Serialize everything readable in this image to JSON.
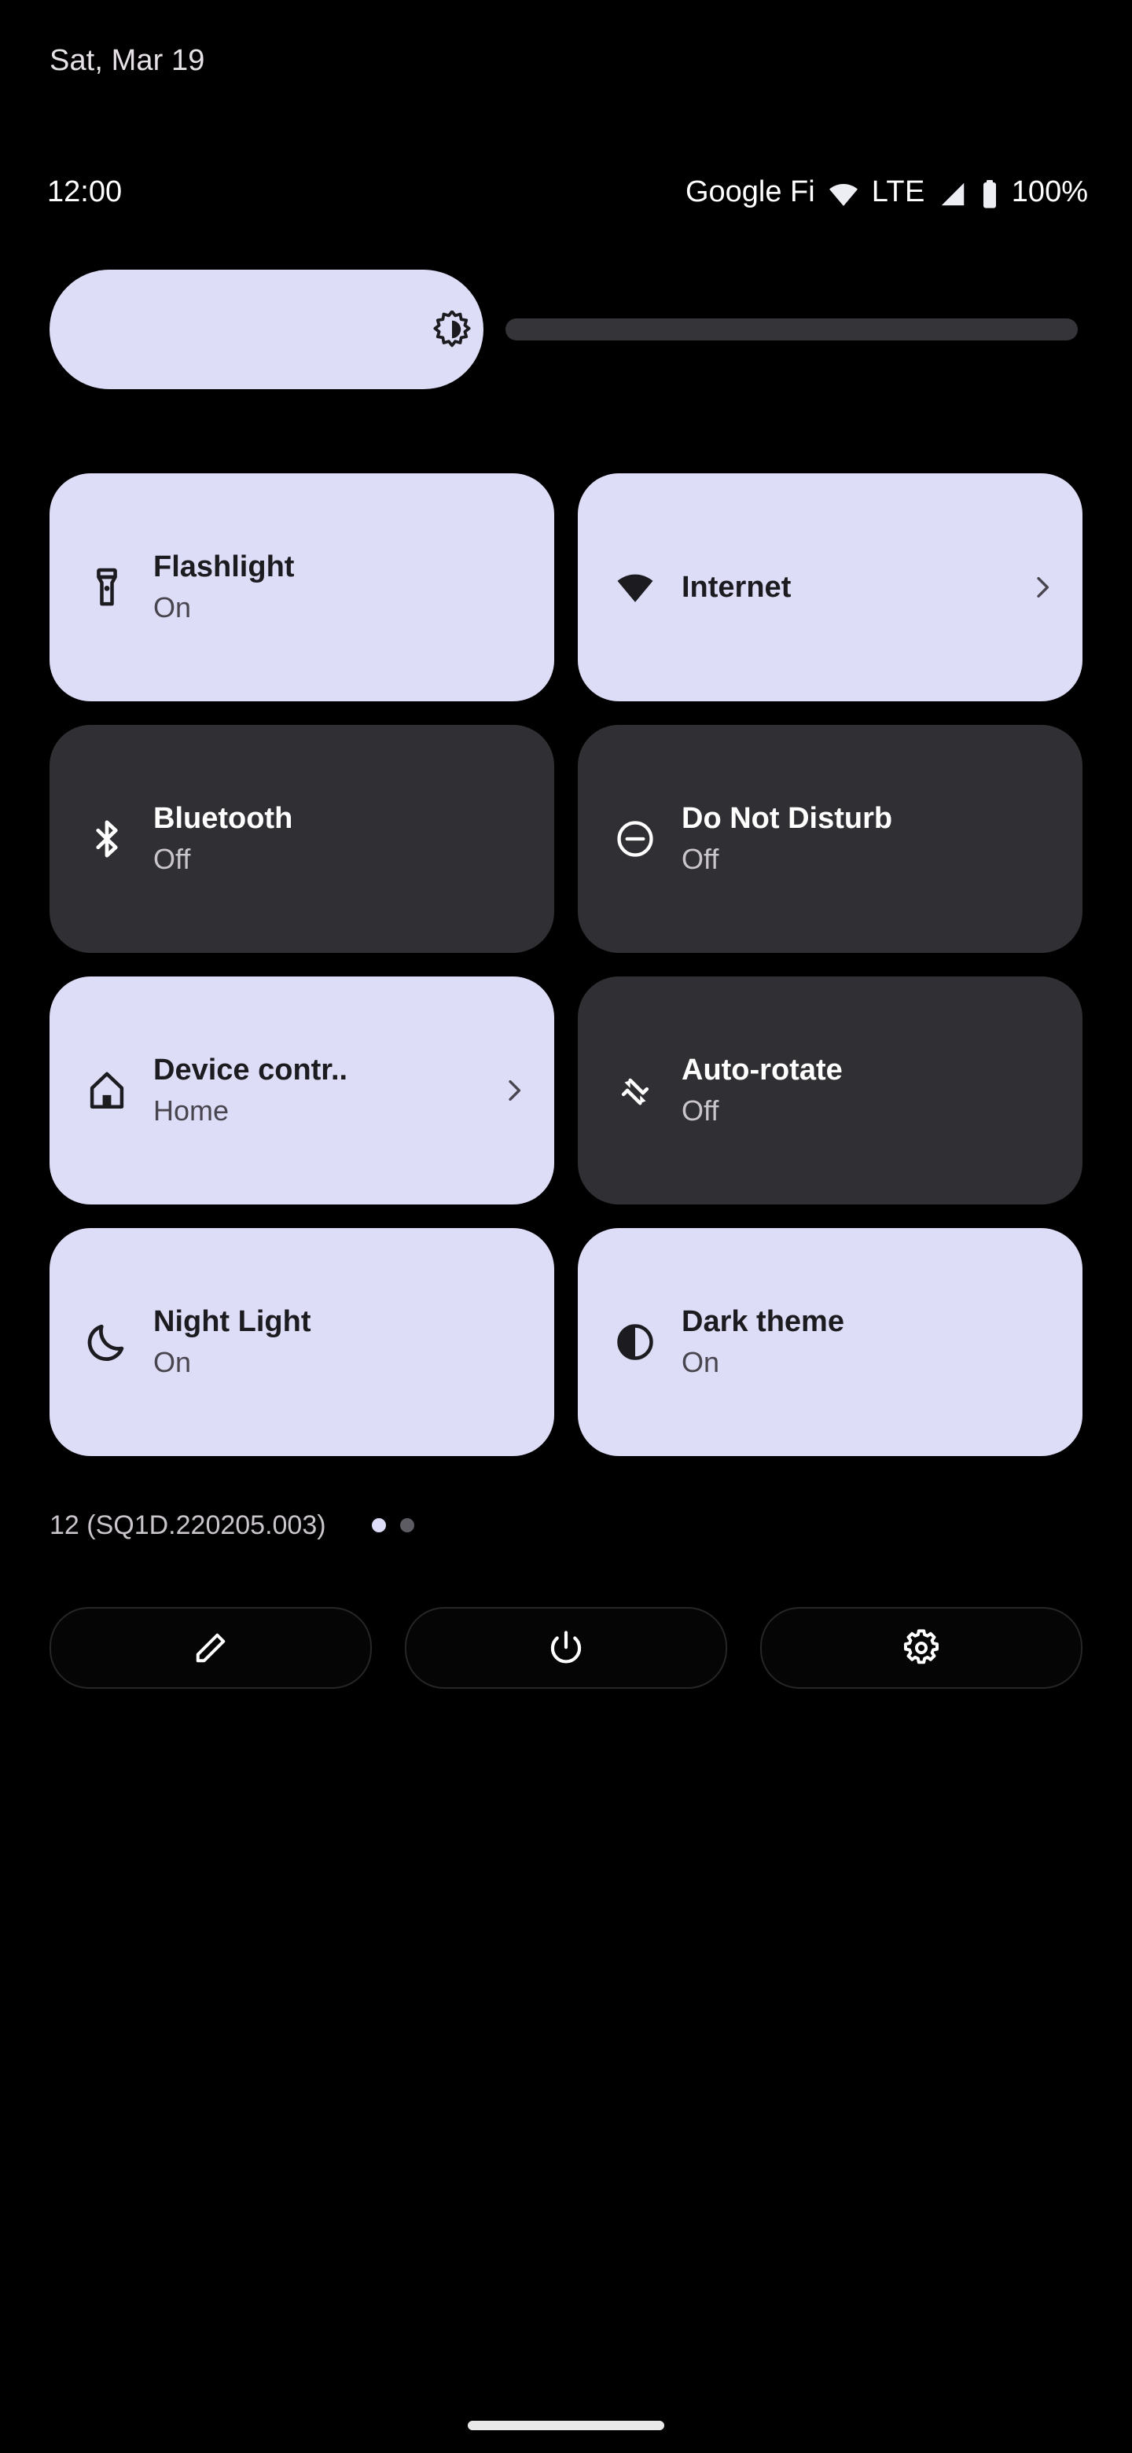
{
  "statusbar": {
    "date": "Sat, Mar 19",
    "clock": "12:00",
    "carrier": "Google Fi",
    "network_type": "LTE",
    "battery_percent": "100%",
    "wifi_icon": "wifi-icon",
    "signal_icon": "cell-signal-icon",
    "battery_icon": "battery-full-icon"
  },
  "brightness": {
    "name": "brightness-slider",
    "icon": "brightness-icon",
    "value_percent": 42,
    "fill_color": "#DEDDF8",
    "track_color": "#353438"
  },
  "colors": {
    "background": "#000000",
    "tile_active_bg": "#DEDDF8",
    "tile_inactive_bg": "#303034",
    "tile_active_text": "#1C1B1F",
    "tile_active_subtext": "#49454E",
    "tile_inactive_text": "#FFFFFF",
    "tile_inactive_subtext": "#C9C5CA",
    "dot_active": "#DEDDF8",
    "dot_inactive": "#5C5C62"
  },
  "tiles": [
    {
      "id": "flashlight",
      "label": "Flashlight",
      "sub": "On",
      "state": "active",
      "icon": "flashlight-icon",
      "chevron": false
    },
    {
      "id": "internet",
      "label": "Internet",
      "sub": "",
      "state": "active",
      "icon": "wifi-icon",
      "chevron": true
    },
    {
      "id": "bluetooth",
      "label": "Bluetooth",
      "sub": "Off",
      "state": "inactive",
      "icon": "bluetooth-icon",
      "chevron": false
    },
    {
      "id": "do-not-disturb",
      "label": "Do Not Disturb",
      "sub": "Off",
      "state": "inactive",
      "icon": "do-not-disturb-icon",
      "chevron": false
    },
    {
      "id": "device-controls",
      "label": "Device contr..",
      "sub": "Home",
      "state": "active",
      "icon": "home-icon",
      "chevron": true
    },
    {
      "id": "auto-rotate",
      "label": "Auto-rotate",
      "sub": "Off",
      "state": "inactive",
      "icon": "auto-rotate-icon",
      "chevron": false
    },
    {
      "id": "night-light",
      "label": "Night Light",
      "sub": "On",
      "state": "active",
      "icon": "moon-icon",
      "chevron": false
    },
    {
      "id": "dark-theme",
      "label": "Dark theme",
      "sub": "On",
      "state": "active",
      "icon": "contrast-icon",
      "chevron": false
    }
  ],
  "footer": {
    "build": "12 (SQ1D.220205.003)",
    "pages": {
      "total": 2,
      "current": 1
    }
  },
  "actions": [
    {
      "id": "edit",
      "icon": "pencil-icon"
    },
    {
      "id": "power",
      "icon": "power-icon"
    },
    {
      "id": "settings",
      "icon": "gear-icon"
    }
  ],
  "navbar": {
    "handle": "home-gesture-handle"
  }
}
